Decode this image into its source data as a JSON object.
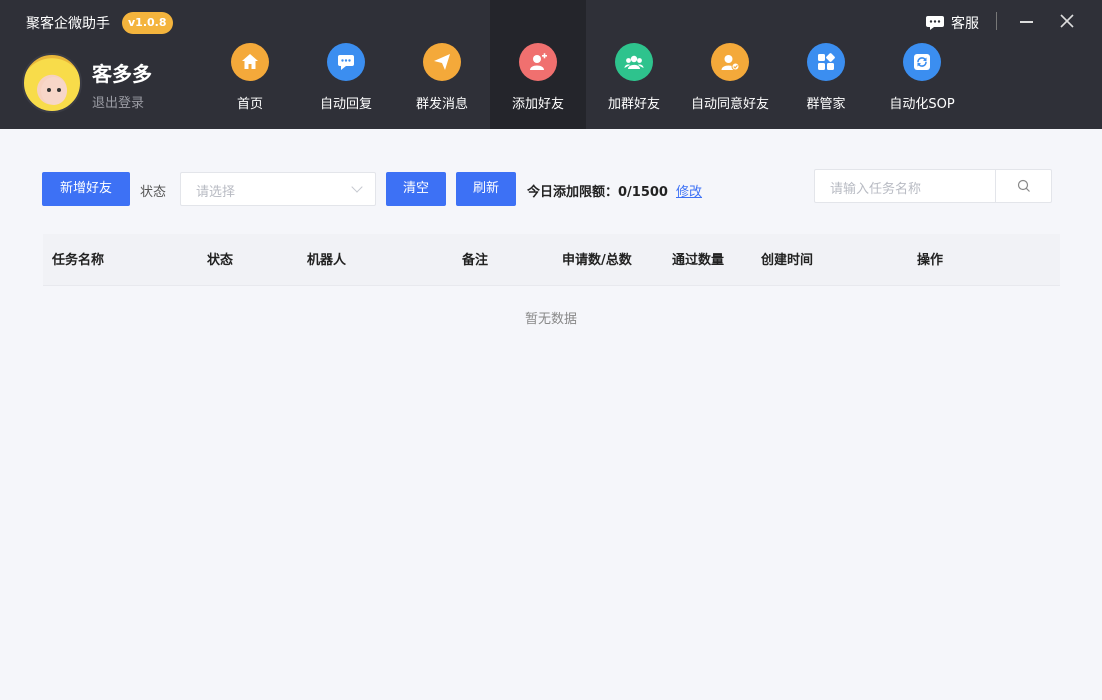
{
  "app": {
    "title": "聚客企微助手",
    "version": "v1.0.8",
    "customer_service": "客服"
  },
  "user": {
    "name": "客多多",
    "logout": "退出登录"
  },
  "nav": [
    {
      "label": "首页",
      "icon": "home-icon",
      "color": "#f4a93a"
    },
    {
      "label": "自动回复",
      "icon": "chat-bubble-icon",
      "color": "#3b8ef0"
    },
    {
      "label": "群发消息",
      "icon": "send-icon",
      "color": "#f4a93a"
    },
    {
      "label": "添加好友",
      "icon": "add-user-icon",
      "color": "#f0706f",
      "active": true
    },
    {
      "label": "加群好友",
      "icon": "group-icon",
      "color": "#2ec38d"
    },
    {
      "label": "自动同意好友",
      "icon": "accept-user-icon",
      "color": "#f4a93a"
    },
    {
      "label": "群管家",
      "icon": "apps-icon",
      "color": "#3b8ef0"
    },
    {
      "label": "自动化SOP",
      "icon": "cycle-icon",
      "color": "#3b8ef0"
    }
  ],
  "toolbar": {
    "add_friend": "新增好友",
    "status_label": "状态",
    "status_placeholder": "请选择",
    "clear": "清空",
    "refresh": "刷新",
    "limit_text": "今日添加限额：0/1500",
    "modify": "修改",
    "search_placeholder": "请输入任务名称"
  },
  "table": {
    "columns": [
      "任务名称",
      "状态",
      "机器人",
      "备注",
      "申请数/总数",
      "通过数量",
      "创建时间",
      "操作"
    ],
    "empty": "暂无数据"
  },
  "colors": {
    "header_bg": "#2f3038",
    "primary": "#3d71f5",
    "badge": "#f4b43d"
  }
}
